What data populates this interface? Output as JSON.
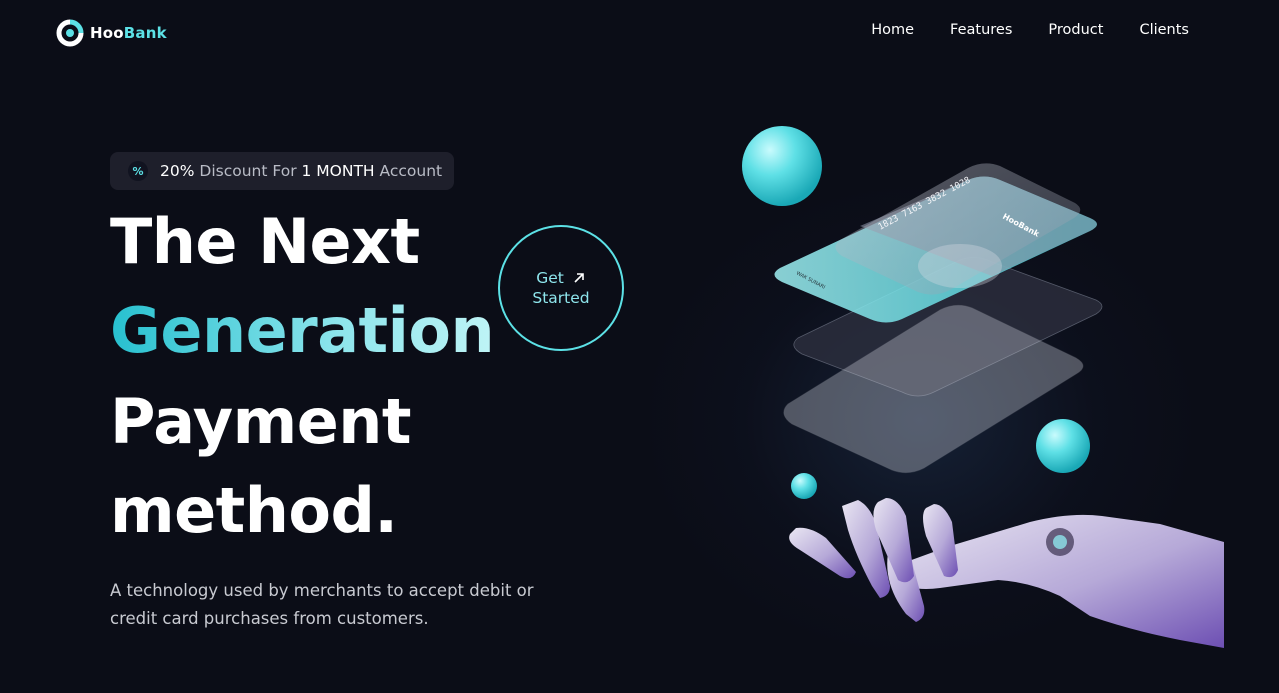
{
  "brand": {
    "name_part1": "Hoo",
    "name_part2": "Bank",
    "accent": "#5ce1e6"
  },
  "nav": {
    "items": [
      {
        "label": "Home"
      },
      {
        "label": "Features"
      },
      {
        "label": "Product"
      },
      {
        "label": "Clients"
      }
    ]
  },
  "hero": {
    "discount": {
      "icon": "percent-icon",
      "percent": "20%",
      "text1": " Discount For ",
      "duration": "1 MONTH",
      "text2": " Account"
    },
    "title_line1": "The Next",
    "title_line2": "Generation",
    "title_line3": "Payment",
    "title_line4": "method.",
    "description": "A technology used by merchants to accept debit or credit card purchases from customers.",
    "cta": {
      "line1": "Get",
      "line2": "Started",
      "icon": "arrow-up-right-icon"
    }
  },
  "illustration": {
    "card_number": "1823 7163 3832 1028",
    "card_holder": "WAK SUNARI",
    "card_brand": "HooBank"
  }
}
